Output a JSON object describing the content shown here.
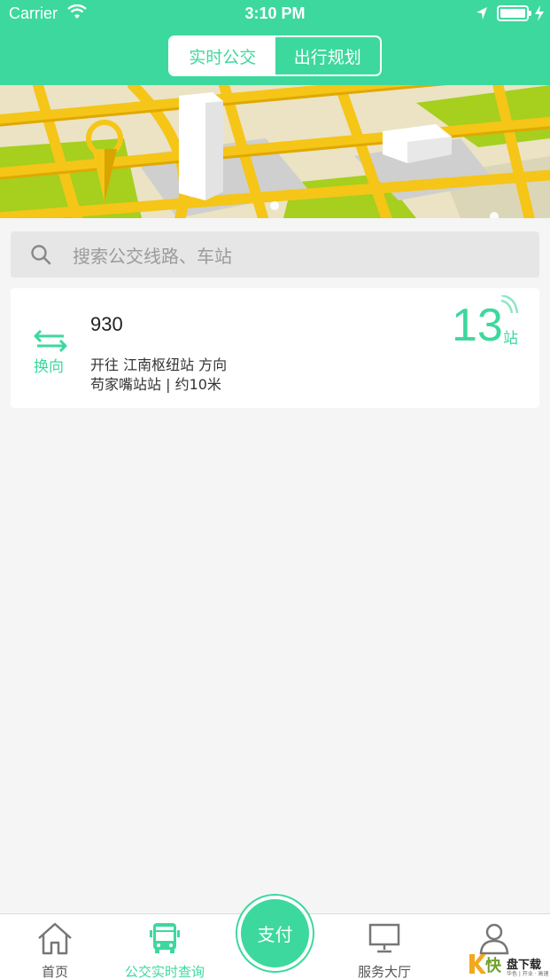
{
  "status_bar": {
    "carrier": "Carrier",
    "time": "3:10 PM"
  },
  "segments": {
    "active": "实时公交",
    "inactive": "出行规划"
  },
  "search": {
    "placeholder": "搜索公交线路、车站"
  },
  "bus_card": {
    "swap_label": "换向",
    "route": "930",
    "direction": "开往 江南枢纽站 方向",
    "nearby": "苟家嘴站站 | 约10米",
    "stops_away": "13",
    "stops_unit": "站"
  },
  "tabs": [
    {
      "label": "首页",
      "icon": "home-icon",
      "active": false
    },
    {
      "label": "公交实时查询",
      "icon": "bus-icon",
      "active": true
    },
    {
      "label": "支付",
      "icon": "pay-button"
    },
    {
      "label": "服务大厅",
      "icon": "monitor-icon",
      "active": false
    },
    {
      "label": "",
      "icon": "user-icon",
      "active": false
    }
  ],
  "watermark": {
    "char": "快",
    "name": "盘下载",
    "tagline": "华色 | 开业 · 高速"
  },
  "colors": {
    "accent": "#3dd89e",
    "road": "#f5c518",
    "grass": "#9ccc1c"
  }
}
